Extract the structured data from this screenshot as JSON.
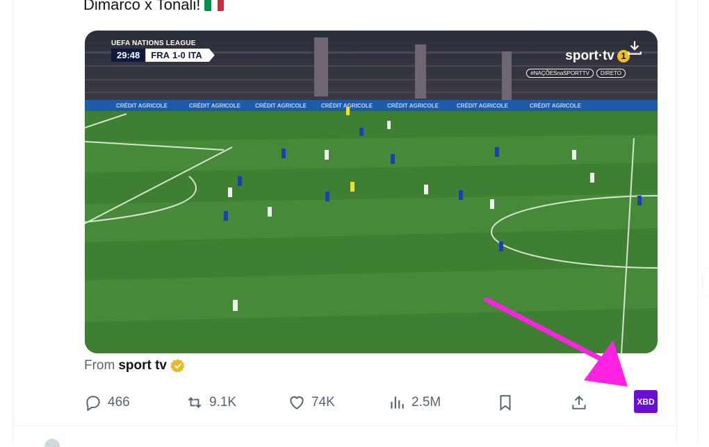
{
  "tweet": {
    "text": "Dimarco x Tonali!",
    "flag": {
      "colors": [
        "#009246",
        "#ffffff",
        "#ce2b37"
      ],
      "icon": "italy-flag-emoji"
    }
  },
  "video": {
    "competition": "UEFA NATIONS LEAGUE",
    "clock": "29:48",
    "home": "FRA",
    "score": "1-0",
    "away": "ITA",
    "broadcaster": "sport·tv",
    "channel_number": "1",
    "tags": [
      "#NAÇÕESnaSPORTTV",
      "DIRETO"
    ],
    "ad_board_text": "CRÉDIT AGRICOLE"
  },
  "source": {
    "prefix": "From",
    "name": "sport tv",
    "badge_color": "#e8b829"
  },
  "actions": {
    "replies": "466",
    "reposts": "9.1K",
    "likes": "74K",
    "views": "2.5M"
  },
  "extension": {
    "label": "XBD",
    "color": "#6a0fd2"
  },
  "annotation": {
    "arrow_color": "#ff22e0"
  }
}
